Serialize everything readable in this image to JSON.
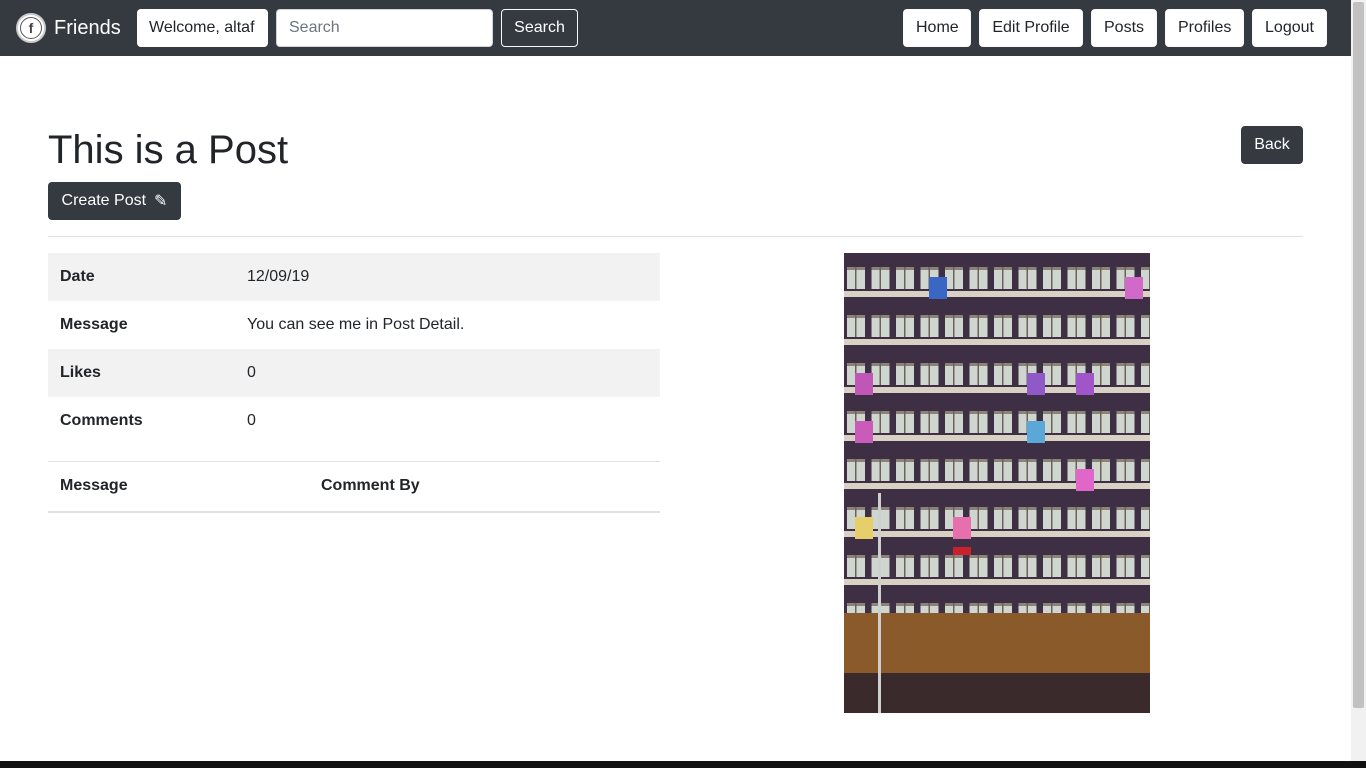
{
  "navbar": {
    "brand": "Friends",
    "brand_logo_glyph": "f",
    "welcome": "Welcome, altaf",
    "search_placeholder": "Search",
    "search_button": "Search",
    "links": [
      "Home",
      "Edit Profile",
      "Posts",
      "Profiles",
      "Logout"
    ]
  },
  "page": {
    "title": "This is a Post",
    "back_button": "Back",
    "create_button": "Create Post",
    "create_icon": "pencil-icon"
  },
  "details": [
    {
      "key": "Date",
      "value": "12/09/19"
    },
    {
      "key": "Message",
      "value": "You can see me in Post Detail."
    },
    {
      "key": "Likes",
      "value": "0"
    },
    {
      "key": "Comments",
      "value": "0"
    }
  ],
  "comments_table": {
    "headers": [
      "Message",
      "Comment By"
    ]
  },
  "colors": {
    "navbar_bg": "#343a40",
    "button_dark": "#343a40",
    "stripe": "#f2f2f2"
  }
}
